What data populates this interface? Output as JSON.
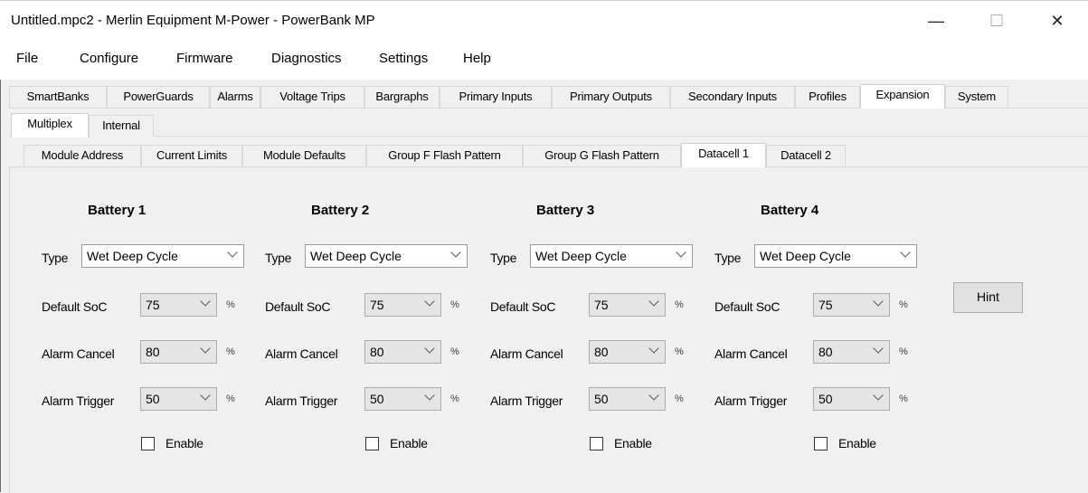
{
  "window": {
    "title": "Untitled.mpc2 - Merlin Equipment M-Power - PowerBank MP",
    "minimize_glyph": "—",
    "maximize_glyph": "☐",
    "close_glyph": "✕"
  },
  "menu": [
    "File",
    "Configure",
    "Firmware",
    "Diagnostics",
    "Settings",
    "Help"
  ],
  "main_tabs": [
    "SmartBanks",
    "PowerGuards",
    "Alarms",
    "Voltage Trips",
    "Bargraphs",
    "Primary Inputs",
    "Primary Outputs",
    "Secondary Inputs",
    "Profiles",
    "Expansion",
    "System"
  ],
  "main_tab_active": "Expansion",
  "sub_tabs": [
    "Multiplex",
    "Internal"
  ],
  "sub_tab_active": "Multiplex",
  "section_tabs": [
    "Module Address",
    "Current Limits",
    "Module Defaults",
    "Group F Flash Pattern",
    "Group G Flash Pattern",
    "Datacell 1",
    "Datacell 2"
  ],
  "section_tab_active": "Datacell 1",
  "labels": {
    "type": "Type",
    "default_soc": "Default SoC",
    "alarm_cancel": "Alarm Cancel",
    "alarm_trigger": "Alarm Trigger",
    "percent": "%",
    "enable": "Enable"
  },
  "batteries": [
    {
      "title": "Battery 1",
      "type": "Wet Deep Cycle",
      "default_soc": "75",
      "alarm_cancel": "80",
      "alarm_trigger": "50",
      "enabled": false
    },
    {
      "title": "Battery 2",
      "type": "Wet Deep Cycle",
      "default_soc": "75",
      "alarm_cancel": "80",
      "alarm_trigger": "50",
      "enabled": false
    },
    {
      "title": "Battery 3",
      "type": "Wet Deep Cycle",
      "default_soc": "75",
      "alarm_cancel": "80",
      "alarm_trigger": "50",
      "enabled": false
    },
    {
      "title": "Battery 4",
      "type": "Wet Deep Cycle",
      "default_soc": "75",
      "alarm_cancel": "80",
      "alarm_trigger": "50",
      "enabled": false
    }
  ],
  "hint_button": "Hint"
}
